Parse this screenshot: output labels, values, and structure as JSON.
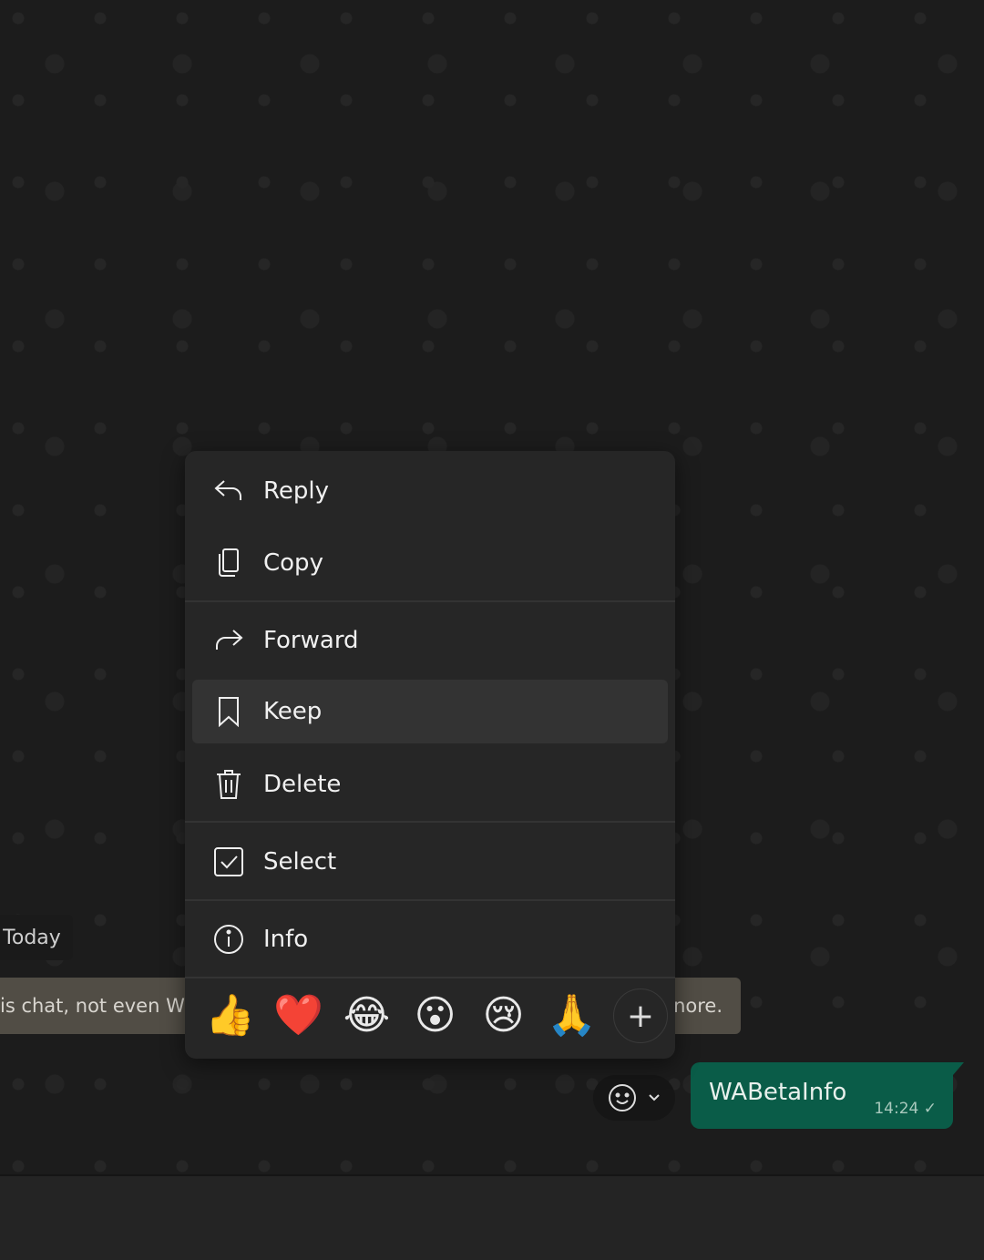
{
  "chat": {
    "date_chip": "Today",
    "system_message_left": "is chat, not even W",
    "system_message_right": "nore.",
    "outgoing_message": {
      "text": "WABetaInfo",
      "time": "14:24",
      "status": "sent-check",
      "bubble_color": "#0a5c48"
    }
  },
  "context_menu": {
    "items": [
      {
        "label": "Reply",
        "icon": "reply-icon"
      },
      {
        "label": "Copy",
        "icon": "copy-icon"
      },
      {
        "label": "Forward",
        "icon": "forward-icon"
      },
      {
        "label": "Keep",
        "icon": "bookmark-icon",
        "highlighted": true
      },
      {
        "label": "Delete",
        "icon": "trash-icon"
      },
      {
        "label": "Select",
        "icon": "checkbox-icon"
      },
      {
        "label": "Info",
        "icon": "info-icon"
      }
    ],
    "reactions": [
      "👍",
      "❤️",
      "😂",
      "😮",
      "😢",
      "🙏"
    ],
    "more_reactions": "+"
  }
}
